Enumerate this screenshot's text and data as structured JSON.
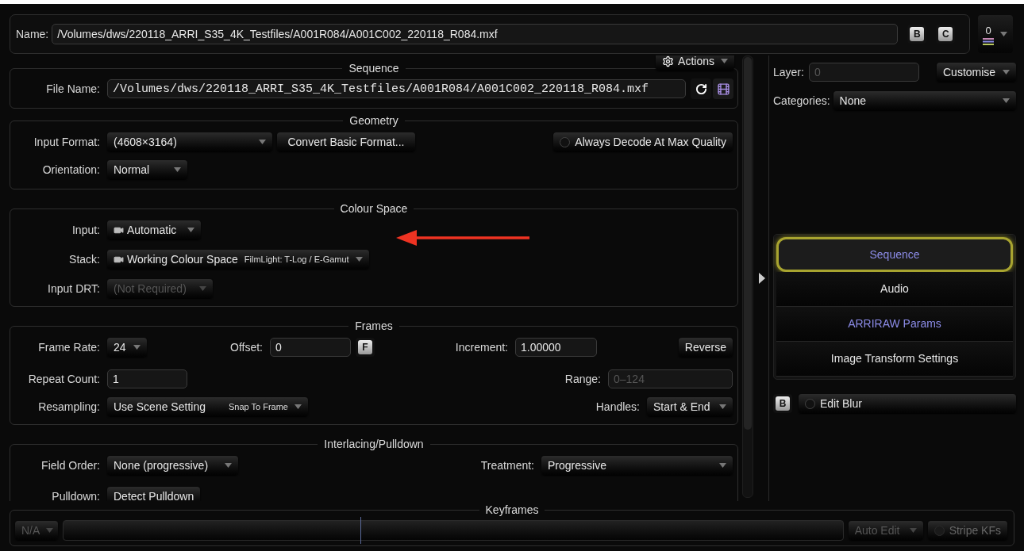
{
  "name_bar": {
    "label": "Name:",
    "value": "/Volumes/dws/220118_ARRI_S35_4K_Testfiles/A001R084/A001C002_220118_R084.mxf",
    "buttons": [
      "B",
      "C"
    ],
    "count": "0"
  },
  "sequence": {
    "title": "Sequence",
    "actions": "Actions",
    "file_label": "File Name:",
    "file_value": "/Volumes/dws/220118_ARRI_S35_4K_Testfiles/A001R084/A001C002_220118_R084.mxf"
  },
  "geometry": {
    "title": "Geometry",
    "input_format": {
      "label": "Input Format:",
      "value": "(4608×3164)"
    },
    "convert_button": "Convert Basic Format...",
    "max_quality": {
      "label": "Always Decode At Max Quality",
      "on": false
    },
    "orientation": {
      "label": "Orientation:",
      "value": "Normal"
    }
  },
  "colour_space": {
    "title": "Colour Space",
    "input": {
      "label": "Input:",
      "value": "Automatic"
    },
    "stack": {
      "label": "Stack:",
      "value": "Working Colour Space",
      "detail": "FilmLight: T-Log / E-Gamut"
    },
    "input_drt": {
      "label": "Input DRT:",
      "value": "(Not Required)",
      "disabled": true
    }
  },
  "frames": {
    "title": "Frames",
    "frame_rate": {
      "label": "Frame Rate:",
      "value": "24"
    },
    "offset": {
      "label": "Offset:",
      "value": "0",
      "button": "F"
    },
    "increment": {
      "label": "Increment:",
      "value": "1.00000"
    },
    "reverse": "Reverse",
    "repeat_count": {
      "label": "Repeat Count:",
      "value": "1"
    },
    "range": {
      "label": "Range:",
      "placeholder": "0–124"
    },
    "resampling": {
      "label": "Resampling:",
      "value": "Use Scene Setting",
      "detail": "Snap To Frame"
    },
    "handles": {
      "label": "Handles:",
      "value": "Start & End"
    }
  },
  "interlacing": {
    "title": "Interlacing/Pulldown",
    "field_order": {
      "label": "Field Order:",
      "value": "None (progressive)"
    },
    "treatment": {
      "label": "Treatment:",
      "value": "Progressive"
    },
    "pulldown": {
      "label": "Pulldown:",
      "button": "Detect Pulldown"
    }
  },
  "right_panel": {
    "layer": {
      "label": "Layer:",
      "placeholder": "0"
    },
    "customise": "Customise",
    "categories": {
      "label": "Categories:",
      "value": "None"
    },
    "tabs": [
      {
        "label": "Sequence",
        "selected": true,
        "color": "#8c8ce8"
      },
      {
        "label": "Audio",
        "selected": false,
        "color": "#e6e6e6"
      },
      {
        "label": "ARRIRAW Params",
        "selected": false,
        "color": "#8c8ce8"
      },
      {
        "label": "Image Transform Settings",
        "selected": false,
        "color": "#e6e6e6"
      }
    ],
    "edit_blur": {
      "badge": "B",
      "label": "Edit Blur",
      "on": false
    }
  },
  "keyframes": {
    "title": "Keyframes",
    "mode": {
      "value": "N/A",
      "disabled": true
    },
    "auto_edit": {
      "value": "Auto Edit",
      "disabled": true
    },
    "stripe": {
      "label": "Stripe KFs",
      "on": false,
      "disabled": true
    }
  }
}
